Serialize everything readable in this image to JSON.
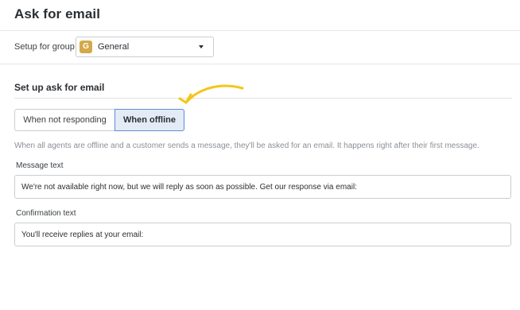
{
  "header": {
    "title": "Ask for email"
  },
  "group_setup": {
    "label": "Setup for group",
    "selected": {
      "badge": "G",
      "name": "General",
      "icon": "chevron-down-icon"
    }
  },
  "section": {
    "heading": "Set up ask for email",
    "toggle": {
      "options": [
        "When not responding",
        "When offline"
      ],
      "selected": "When offline"
    },
    "helper_text": "When all agents are offline and a customer sends a message, they'll be asked for an email. It happens right after their first message."
  },
  "fields": {
    "message": {
      "label": "Message text",
      "value": "We're not available right now, but we will reply as soon as possible. Get our response via email:"
    },
    "confirmation": {
      "label": "Confirmation text",
      "value": "You'll receive replies at your email:"
    }
  },
  "colors": {
    "accent": "#5b8fd6",
    "active_toggle_bg": "#e3ebf7",
    "group_badge": "#d4a94a",
    "annotation_arrow": "#f5c518"
  }
}
